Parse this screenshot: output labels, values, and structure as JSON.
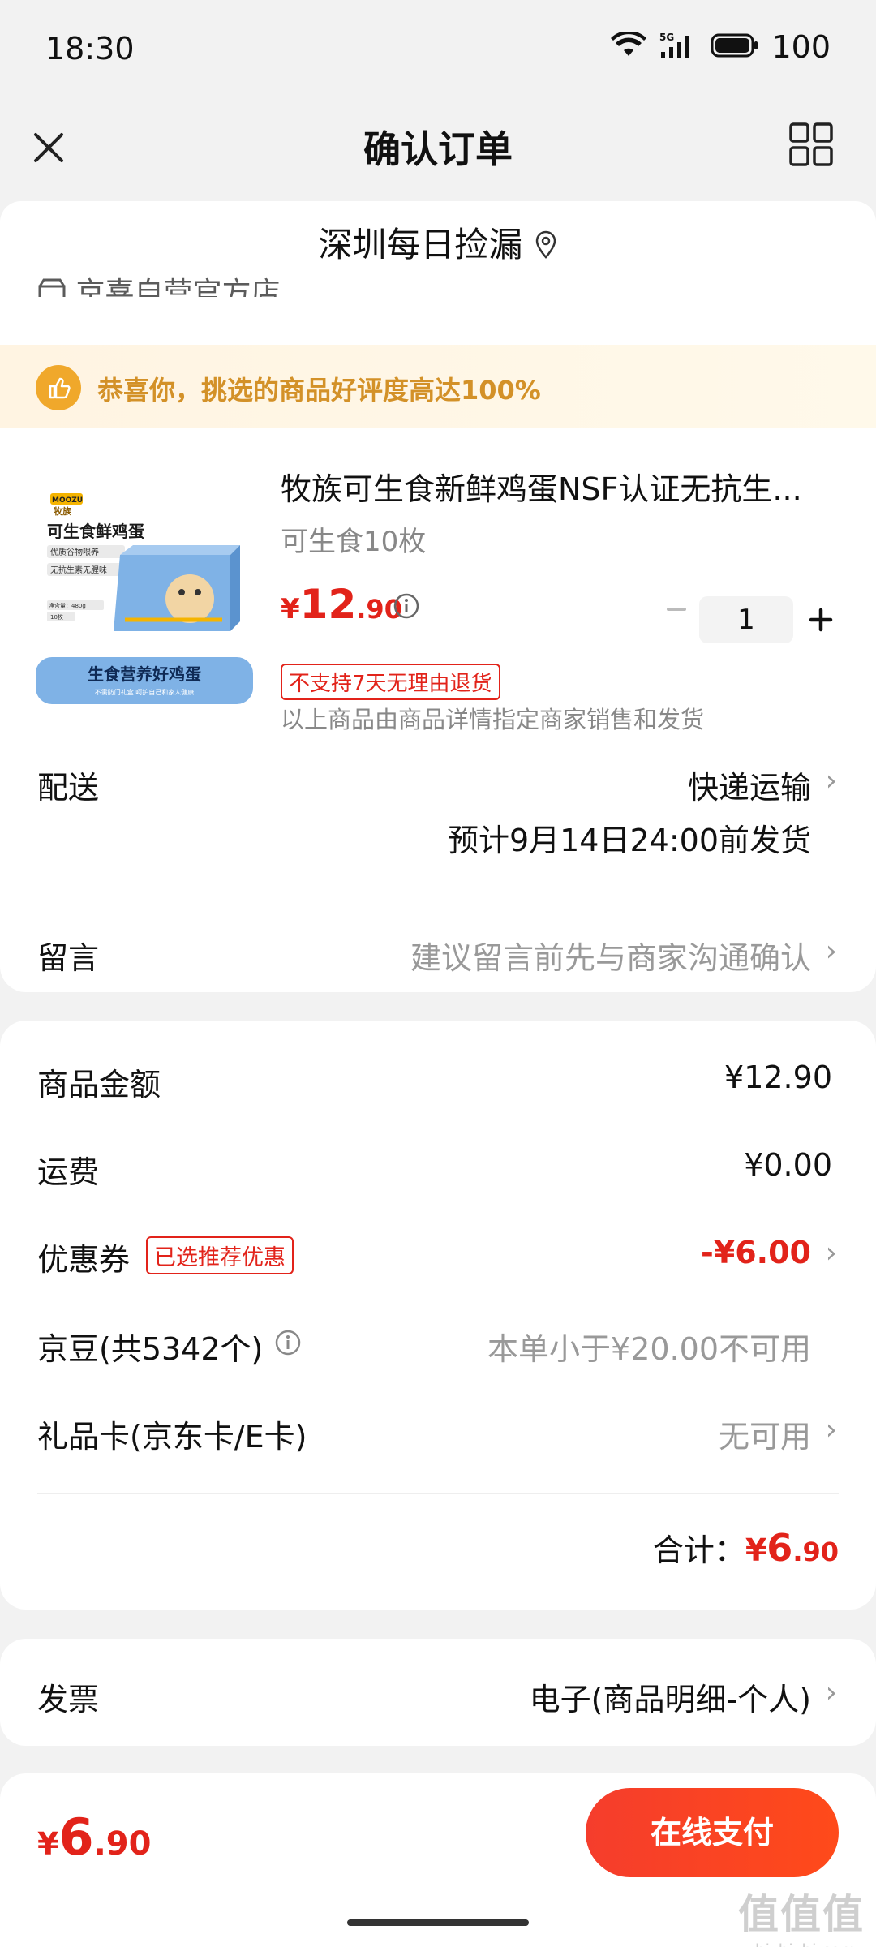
{
  "status": {
    "time": "18:30",
    "battery": "100",
    "network": "5G"
  },
  "nav": {
    "title": "确认订单"
  },
  "store": {
    "title": "深圳每日捡漏",
    "subtitle": "京喜自营官方店"
  },
  "banner": {
    "text": "恭喜你，挑选的商品好评度高达100%"
  },
  "product": {
    "name": "牧族可生食新鲜鸡蛋NSF认证无抗生...",
    "spec": "可生食10枚",
    "price_symbol": "¥",
    "price_int": "12",
    "price_dec": ".90",
    "quantity": "1",
    "return_badge": "不支持7天无理由退货",
    "seller_note": "以上商品由商品详情指定商家销售和发货",
    "image": {
      "brand": "MOOZU",
      "brand_cn": "牧族",
      "title": "可生食鲜鸡蛋",
      "tag1": "优质谷物喂养",
      "tag2": "无抗生素无腥味",
      "footer": "生食营养好鸡蛋",
      "footer_sub": "不需防门礼盒 呵护自己和家人健康",
      "net": "净含量：480g",
      "count": "10枚"
    }
  },
  "delivery": {
    "label": "配送",
    "value": "快递运输",
    "date": "预计9月14日24:00前发货"
  },
  "message": {
    "label": "留言",
    "placeholder": "建议留言前先与商家沟通确认"
  },
  "summary": {
    "goods_label": "商品金额",
    "goods_value": "¥12.90",
    "freight_label": "运费",
    "freight_value": "¥0.00",
    "coupon_label": "优惠券",
    "coupon_badge": "已选推荐优惠",
    "coupon_value": "-¥6.00",
    "beans_label": "京豆(共5342个)",
    "beans_value": "本单小于¥20.00不可用",
    "giftcard_label": "礼品卡(京东卡/E卡)",
    "giftcard_value": "无可用",
    "total_label": "合计：",
    "total_symbol": "¥",
    "total_int": "6",
    "total_dec": ".90"
  },
  "invoice": {
    "label": "发票",
    "value": "电子(商品明细-个人)"
  },
  "bottom": {
    "symbol": "¥",
    "int": "6",
    "dec": ".90",
    "pay_label": "在线支付"
  },
  "watermark": {
    "big": "值值值",
    "small": "zhizhizhi.com"
  },
  "colors": {
    "accent": "#e2231a",
    "banner_text": "#d39128",
    "pay_button": "#f53d2c"
  }
}
